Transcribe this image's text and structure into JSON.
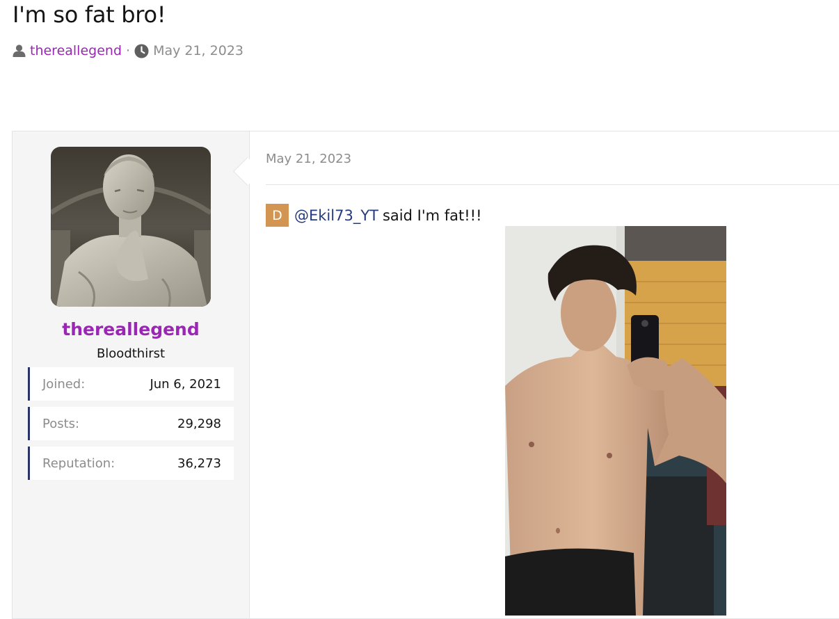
{
  "thread": {
    "title": "I'm so fat bro!",
    "author": "thereallegend",
    "separator": "·",
    "date": "May 21, 2023"
  },
  "user": {
    "name": "thereallegend",
    "title": "Bloodthirst",
    "extras": [
      {
        "label": "Joined:",
        "value": "Jun 6, 2021"
      },
      {
        "label": "Posts:",
        "value": "29,298"
      },
      {
        "label": "Reputation:",
        "value": "36,273"
      }
    ]
  },
  "post": {
    "date": "May 21, 2023",
    "mention_avatar_letter": "D",
    "mention": "@Ekil73_YT",
    "text": "said I'm fat!!!"
  },
  "colors": {
    "username": "#9b26b6",
    "mention": "#243a7c",
    "extra_border": "#2a3466",
    "mini_avatar": "#d39552"
  },
  "icons": {
    "author": "user-icon",
    "date": "clock-icon"
  }
}
